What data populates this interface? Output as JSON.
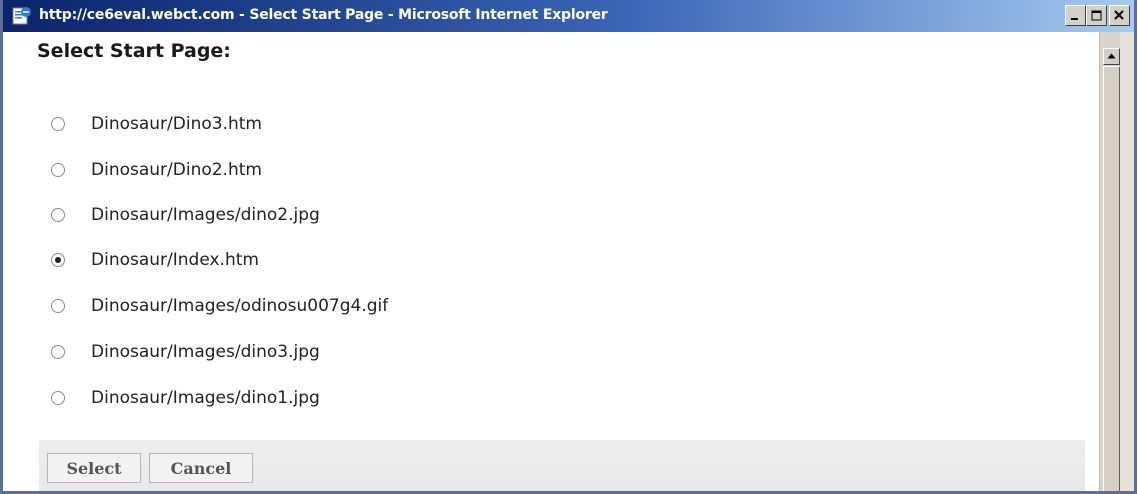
{
  "window": {
    "title": "http://ce6eval.webct.com - Select Start Page - Microsoft Internet Explorer",
    "buttons": [
      "minimize",
      "maximize",
      "close"
    ]
  },
  "dialog": {
    "heading": "Select Start Page:",
    "options": [
      {
        "label": "Dinosaur/Dino3.htm",
        "checked": false
      },
      {
        "label": "Dinosaur/Dino2.htm",
        "checked": false
      },
      {
        "label": "Dinosaur/Images/dino2.jpg",
        "checked": false
      },
      {
        "label": "Dinosaur/Index.htm",
        "checked": true
      },
      {
        "label": "Dinosaur/Images/odinosu007g4.gif",
        "checked": false
      },
      {
        "label": "Dinosaur/Images/dino3.jpg",
        "checked": false
      },
      {
        "label": "Dinosaur/Images/dino1.jpg",
        "checked": false
      }
    ],
    "select_label": "Select",
    "cancel_label": "Cancel"
  },
  "colors": {
    "titlebar_start": "#0a246a",
    "titlebar_end": "#a6caf0",
    "button_bar": "#eeeeee"
  },
  "icons": {
    "title": "ie-page-icon",
    "minimize": "minimize-icon",
    "maximize": "maximize-icon",
    "close": "close-icon",
    "scroll_up": "scroll-up-arrow-icon"
  }
}
